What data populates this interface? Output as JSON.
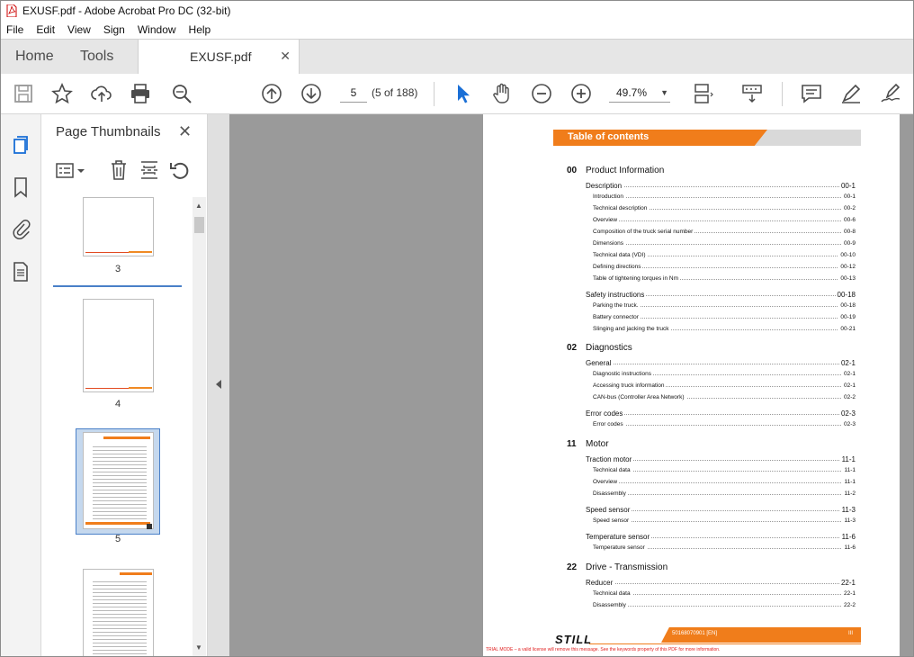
{
  "window": {
    "title": "EXUSF.pdf - Adobe Acrobat Pro DC (32-bit)"
  },
  "menu": [
    "File",
    "Edit",
    "View",
    "Sign",
    "Window",
    "Help"
  ],
  "tabs": {
    "home": "Home",
    "tools": "Tools",
    "document": "EXUSF.pdf"
  },
  "toolbar": {
    "page_number": "5",
    "page_of": "(5 of 188)",
    "zoom": "49.7%",
    "icons": [
      "save-icon",
      "bookmark-star-icon",
      "share-cloud-icon",
      "print-icon",
      "search-icon",
      "page-up-icon",
      "page-down-icon",
      "select-pointer-icon",
      "hand-icon",
      "zoom-out-icon",
      "zoom-in-icon",
      "fit-page-icon",
      "scroll-mode-icon",
      "comment-icon",
      "highlight-pen-icon",
      "sign-icon"
    ]
  },
  "sidebar": {
    "title": "Page Thumbnails",
    "thumbnails": [
      {
        "label": "3"
      },
      {
        "label": "4"
      },
      {
        "label": "5",
        "selected": true
      },
      {
        "label": ""
      }
    ]
  },
  "document": {
    "toc_title": "Table of contents",
    "sections": [
      {
        "num": "00",
        "title": "Product Information",
        "groups": [
          {
            "title": "Description",
            "page": "00-1",
            "items": [
              {
                "title": "Introduction",
                "page": "00-1"
              },
              {
                "title": "Technical description",
                "page": "00-2"
              },
              {
                "title": "Overview",
                "page": "00-6"
              },
              {
                "title": "Composition of the truck serial number",
                "page": "00-8"
              },
              {
                "title": "Dimensions",
                "page": "00-9"
              },
              {
                "title": "Technical data (VDI)",
                "page": "00-10"
              },
              {
                "title": "Defining directions",
                "page": "00-12"
              },
              {
                "title": "Table of tightening torques in Nm",
                "page": "00-13"
              }
            ]
          },
          {
            "title": "Safety instructions",
            "page": "00-18",
            "items": [
              {
                "title": "Parking the truck.",
                "page": "00-18"
              },
              {
                "title": "Battery connector",
                "page": "00-19"
              },
              {
                "title": "Slinging and jacking the truck",
                "page": "00-21"
              }
            ]
          }
        ]
      },
      {
        "num": "02",
        "title": "Diagnostics",
        "groups": [
          {
            "title": "General",
            "page": "02-1",
            "items": [
              {
                "title": "Diagnostic instructions",
                "page": "02-1"
              },
              {
                "title": "Accessing truck information",
                "page": "02-1"
              },
              {
                "title": "CAN-bus (Controller Area Network)",
                "page": "02-2"
              }
            ]
          },
          {
            "title": "Error codes",
            "page": "02-3",
            "items": [
              {
                "title": "Error codes",
                "page": "02-3"
              }
            ]
          }
        ]
      },
      {
        "num": "11",
        "title": "Motor",
        "groups": [
          {
            "title": "Traction motor",
            "page": "11-1",
            "items": [
              {
                "title": "Technical data",
                "page": "11-1"
              },
              {
                "title": "Overview",
                "page": "11-1"
              },
              {
                "title": "Disassembly",
                "page": "11-2"
              }
            ]
          },
          {
            "title": "Speed sensor",
            "page": "11-3",
            "items": [
              {
                "title": "Speed sensor",
                "page": "11-3"
              }
            ]
          },
          {
            "title": "Temperature sensor",
            "page": "11-6",
            "items": [
              {
                "title": "Temperature sensor",
                "page": "11-6"
              }
            ]
          }
        ]
      },
      {
        "num": "22",
        "title": "Drive - Transmission",
        "groups": [
          {
            "title": "Reducer",
            "page": "22-1",
            "items": [
              {
                "title": "Technical data",
                "page": "22-1"
              },
              {
                "title": "Disassembly",
                "page": "22-2"
              }
            ]
          }
        ]
      }
    ],
    "footer": {
      "logo": "STILL",
      "code": "50168070901 [EN]",
      "page": "III",
      "trial_notice": "TRIAL MODE – a valid license will remove this message. See the keywords property of this PDF for more information."
    }
  },
  "colors": {
    "accent_orange": "#f07d1b",
    "selection_blue": "#4a80c8",
    "viewer_gray": "#9a9a9a"
  }
}
